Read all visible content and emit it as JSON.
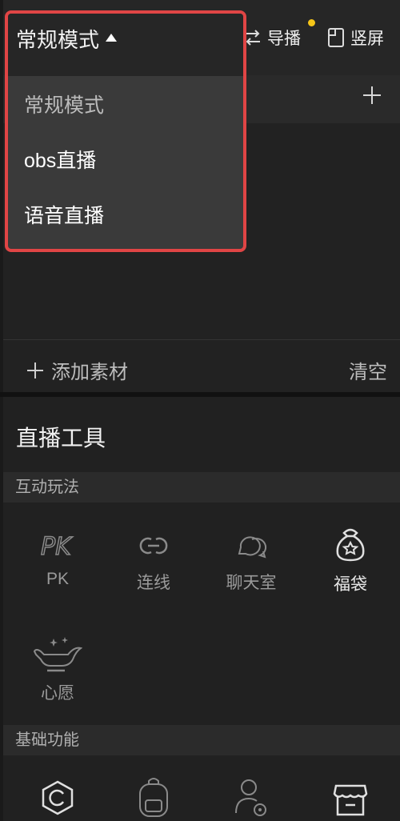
{
  "header": {
    "mode_label": "常规模式",
    "guide_label": "导播",
    "vertical_label": "竖屏",
    "guide_dot_color": "#f5c518"
  },
  "dropdown": {
    "border_color": "#e04545",
    "items": [
      {
        "label": "常规模式",
        "selected": true
      },
      {
        "label": "obs直播",
        "selected": false
      },
      {
        "label": "语音直播",
        "selected": false
      }
    ]
  },
  "source_bar": {
    "add_label": "添加素材",
    "clear_label": "清空"
  },
  "tools": {
    "title": "直播工具",
    "interactive": {
      "heading": "互动玩法",
      "items": [
        {
          "label": "PK",
          "icon": "pk-icon"
        },
        {
          "label": "连线",
          "icon": "link-icon"
        },
        {
          "label": "聊天室",
          "icon": "chatroom-icon"
        },
        {
          "label": "福袋",
          "icon": "lucky-bag-icon"
        },
        {
          "label": "心愿",
          "icon": "wish-lamp-icon"
        }
      ]
    },
    "basic": {
      "heading": "基础功能",
      "items": [
        {
          "icon": "hexagon-icon"
        },
        {
          "icon": "backpack-icon"
        },
        {
          "icon": "user-settings-icon"
        },
        {
          "icon": "shop-icon"
        }
      ]
    }
  }
}
